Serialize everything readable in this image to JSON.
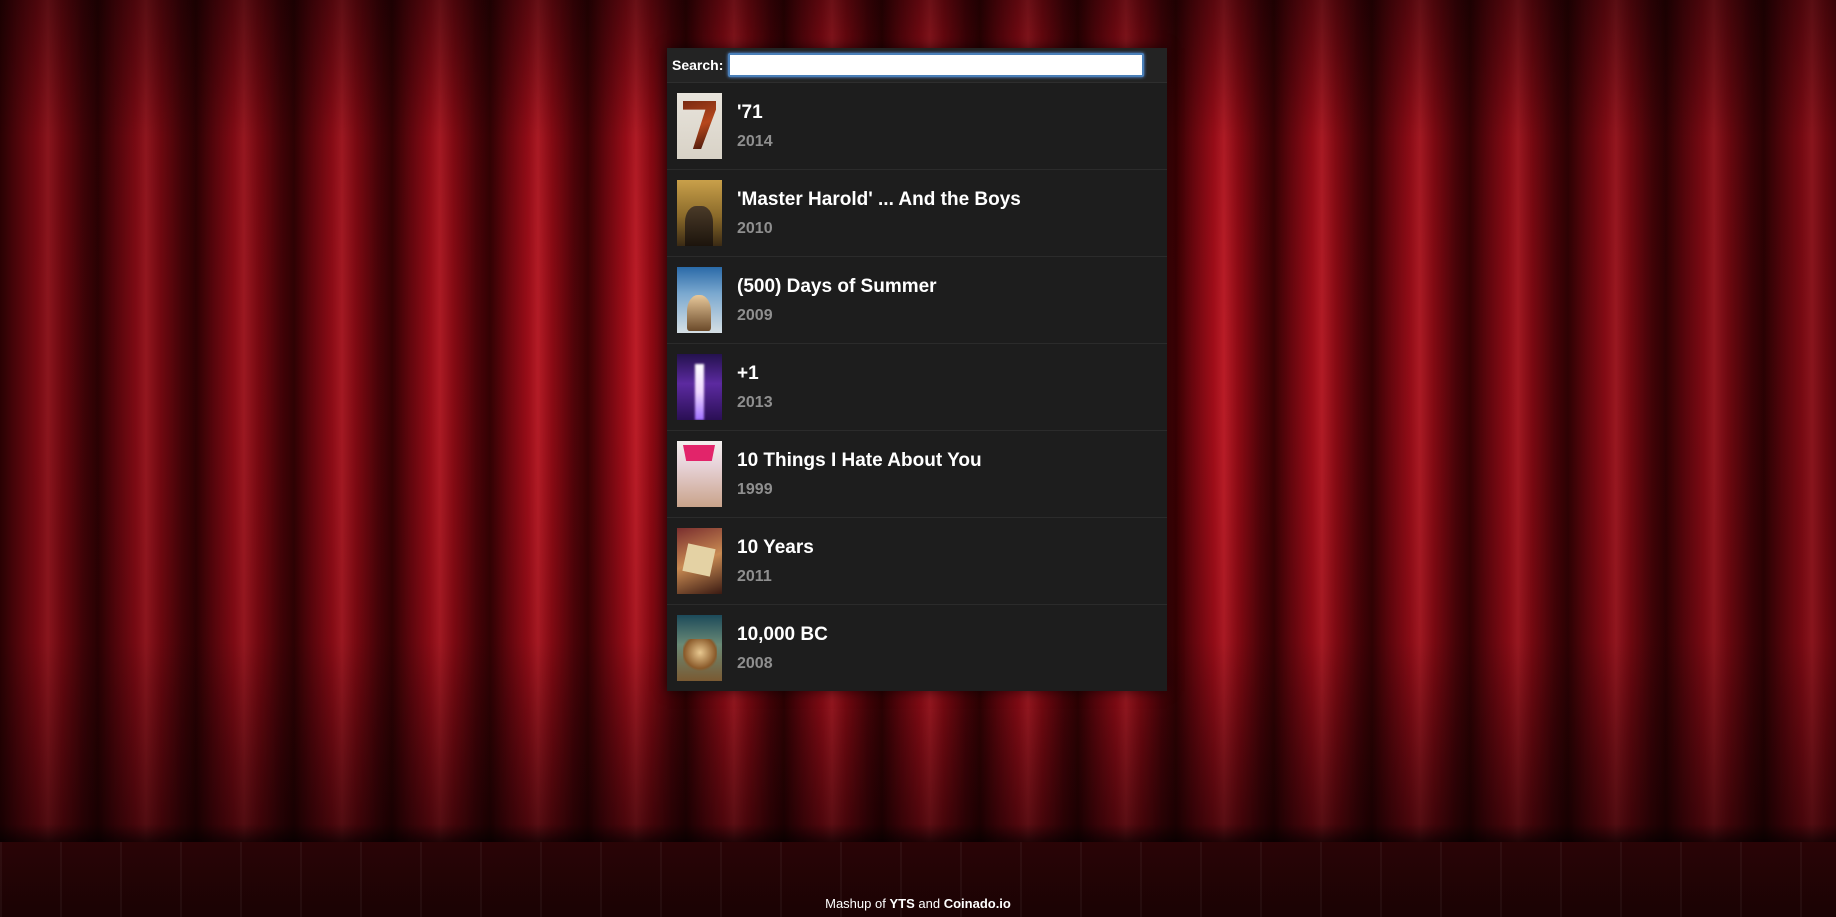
{
  "search": {
    "label": "Search:",
    "value": "",
    "placeholder": ""
  },
  "movies": [
    {
      "title": "'71",
      "year": "2014"
    },
    {
      "title": "'Master Harold' ... And the Boys",
      "year": "2010"
    },
    {
      "title": "(500) Days of Summer",
      "year": "2009"
    },
    {
      "title": "+1",
      "year": "2013"
    },
    {
      "title": "10 Things I Hate About You",
      "year": "1999"
    },
    {
      "title": "10 Years",
      "year": "2011"
    },
    {
      "title": "10,000 BC",
      "year": "2008"
    }
  ],
  "footer": {
    "prefix": "Mashup of",
    "link1": "YTS",
    "conjunction": "and",
    "link2": "Coinado.io"
  },
  "colors": {
    "panel_bg": "#1c1c1c",
    "title_text": "#ffffff",
    "year_text": "#8f8f8f",
    "search_focus_border": "#4a7fb8"
  }
}
